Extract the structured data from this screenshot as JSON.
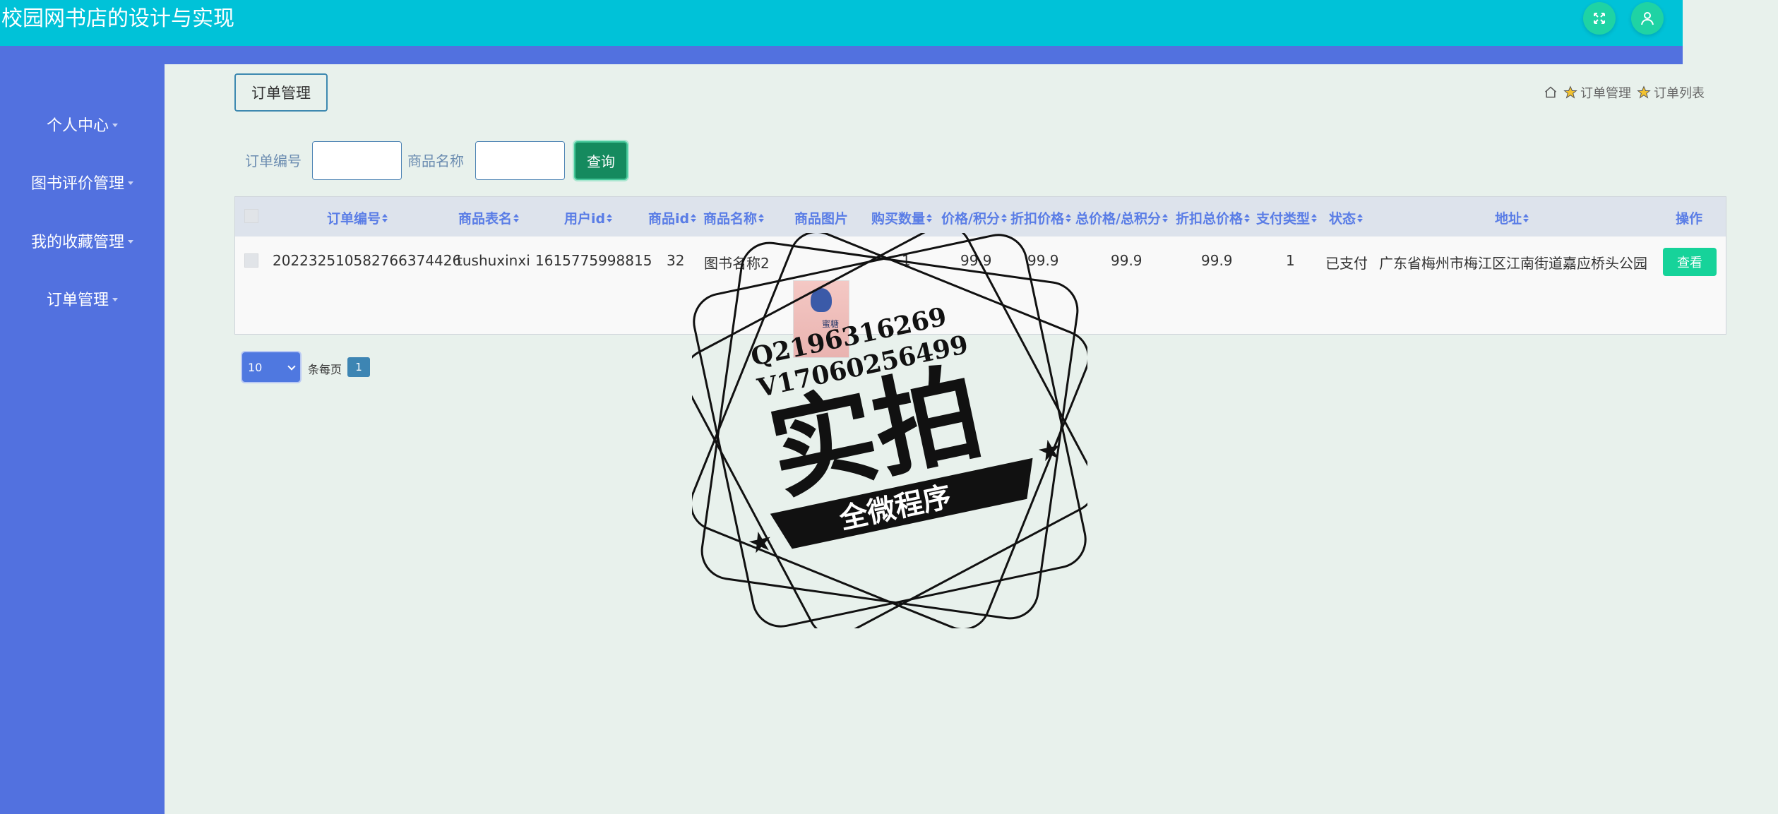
{
  "app": {
    "title": "校园网书店的设计与实现"
  },
  "header_icons": [
    "fullscreen-icon",
    "user-icon"
  ],
  "sidebar": {
    "items": [
      {
        "label": "个人中心"
      },
      {
        "label": "图书评价管理"
      },
      {
        "label": "我的收藏管理"
      },
      {
        "label": "订单管理"
      }
    ]
  },
  "main": {
    "module_button": "订单管理",
    "breadcrumb": {
      "items": [
        "订单管理",
        "订单列表"
      ]
    }
  },
  "search": {
    "order_no_label": "订单编号",
    "order_no_value": "",
    "goods_name_label": "商品名称",
    "goods_name_value": "",
    "query_button": "查询"
  },
  "table": {
    "columns": [
      "订单编号",
      "商品表名",
      "用户id",
      "商品id",
      "商品名称",
      "商品图片",
      "购买数量",
      "价格/积分",
      "折扣价格",
      "总价格/总积分",
      "折扣总价格",
      "支付类型",
      "状态",
      "地址",
      "操作"
    ],
    "rows": [
      {
        "order_no": "20223251058276637442​6",
        "table_name": "tushuxinxi",
        "user_id": "1615775998815",
        "goods_id": "32",
        "goods_name": "图书名称2",
        "goods_image_text": "蜜糖",
        "quantity": "1",
        "price": "99.9",
        "discount_price": "99.9",
        "total_price": "99.9",
        "discount_total": "99.9",
        "pay_type": "1",
        "status": "已支付",
        "address": "广东省梅州市梅江区江南街道嘉应桥头公园",
        "action": "查看"
      }
    ]
  },
  "pagination": {
    "page_size": "10",
    "per_page_label": "条每页",
    "current_page": "1"
  },
  "watermark": {
    "line1": "Q2196316269",
    "line2": "V17060256499",
    "main_text": "实拍",
    "banner_text": "全微程序"
  }
}
